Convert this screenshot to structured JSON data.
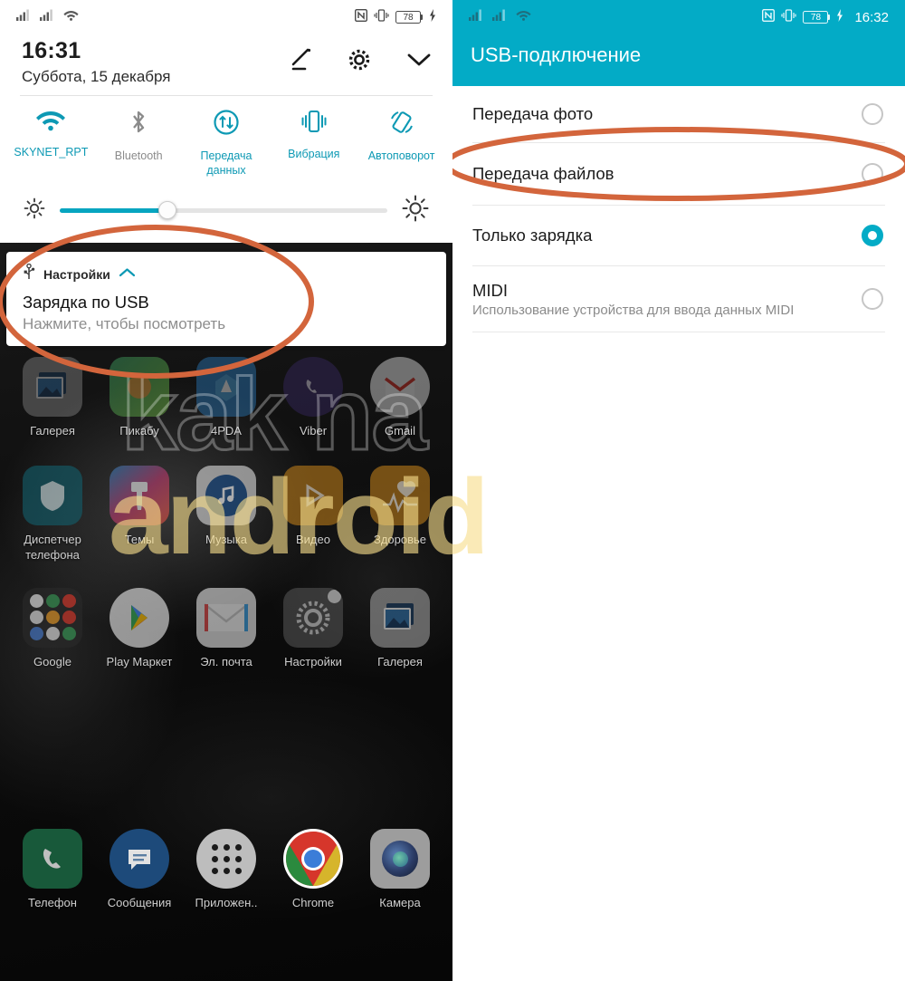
{
  "left_phone": {
    "status_bar": {
      "signal_1_icon": "signal-bars-icon",
      "signal_2_icon": "signal-bars-icon",
      "wifi_icon": "wifi-icon",
      "nfc_icon": "nfc-icon",
      "vibrate_icon": "vibrate-icon",
      "battery_level": "78",
      "charging_icon": "charging-bolt-icon"
    },
    "shade": {
      "time": "16:31",
      "date": "Суббота, 15 декабря",
      "edit_icon": "pencil-edit-icon",
      "settings_icon": "gear-icon",
      "expand_icon": "chevron-down-icon"
    },
    "toggles": [
      {
        "label": "SKYNET_RPT",
        "icon": "wifi-icon",
        "active": true
      },
      {
        "label": "Bluetooth",
        "icon": "bluetooth-icon",
        "active": false
      },
      {
        "label": "Передача данных",
        "icon": "data-transfer-icon",
        "active": true
      },
      {
        "label": "Вибрация",
        "icon": "vibrate-icon",
        "active": true
      },
      {
        "label": "Автоповорот",
        "icon": "auto-rotate-icon",
        "active": true
      }
    ],
    "brightness": {
      "low_icon": "brightness-low-icon",
      "high_icon": "brightness-high-icon",
      "value_percent": 33
    },
    "notification": {
      "usb_icon": "usb-icon",
      "app_name": "Настройки",
      "collapse_icon": "chevron-up-icon",
      "title": "Зарядка по USB",
      "subtitle": "Нажмите, чтобы посмотреть"
    },
    "home_rows": [
      [
        {
          "label": "Галерея",
          "icon": "gallery-icon"
        },
        {
          "label": "Пикабу",
          "icon": "pikabu-icon"
        },
        {
          "label": "4PDA",
          "icon": "fourpda-icon"
        },
        {
          "label": "Viber",
          "icon": "viber-icon"
        },
        {
          "label": "Gmail",
          "icon": "gmail-icon"
        }
      ],
      [
        {
          "label": "Диспетчер телефона",
          "icon": "phone-manager-icon"
        },
        {
          "label": "Темы",
          "icon": "themes-icon"
        },
        {
          "label": "Музыка",
          "icon": "music-icon"
        },
        {
          "label": "Видео",
          "icon": "video-icon"
        },
        {
          "label": "Здоровье",
          "icon": "health-icon"
        }
      ],
      [
        {
          "label": "Google",
          "icon": "google-folder-icon"
        },
        {
          "label": "Play Маркет",
          "icon": "play-store-icon"
        },
        {
          "label": "Эл. почта",
          "icon": "email-icon"
        },
        {
          "label": "Настройки",
          "icon": "settings-gear-icon"
        },
        {
          "label": "Галерея",
          "icon": "gallery-icon"
        }
      ]
    ],
    "dock": [
      {
        "label": "Телефон",
        "icon": "phone-dialer-icon"
      },
      {
        "label": "Сообщения",
        "icon": "messages-icon"
      },
      {
        "label": "Приложен..",
        "icon": "app-drawer-icon"
      },
      {
        "label": "Chrome",
        "icon": "chrome-icon"
      },
      {
        "label": "Камера",
        "icon": "camera-icon"
      }
    ]
  },
  "right_phone": {
    "status_bar": {
      "signal_1_icon": "signal-bars-icon",
      "signal_2_icon": "signal-bars-icon",
      "wifi_icon": "wifi-icon",
      "nfc_icon": "nfc-icon",
      "vibrate_icon": "vibrate-icon",
      "battery_level": "78",
      "charging_icon": "charging-bolt-icon",
      "time": "16:32"
    },
    "header_title": "USB-подключение",
    "options": [
      {
        "title": "Передача фото",
        "subtitle": "",
        "selected": false
      },
      {
        "title": "Передача файлов",
        "subtitle": "",
        "selected": false
      },
      {
        "title": "Только зарядка",
        "subtitle": "",
        "selected": true
      },
      {
        "title": "MIDI",
        "subtitle": "Использование устройства для ввода данных MIDI",
        "selected": false
      }
    ]
  },
  "watermark": {
    "line1": "kak na",
    "line2": "android"
  },
  "colors": {
    "teal_header": "#03abc6",
    "teal_accent": "#0d99b4",
    "annotation_orange": "#d3653c",
    "inactive_gray": "#8b8b8b"
  }
}
